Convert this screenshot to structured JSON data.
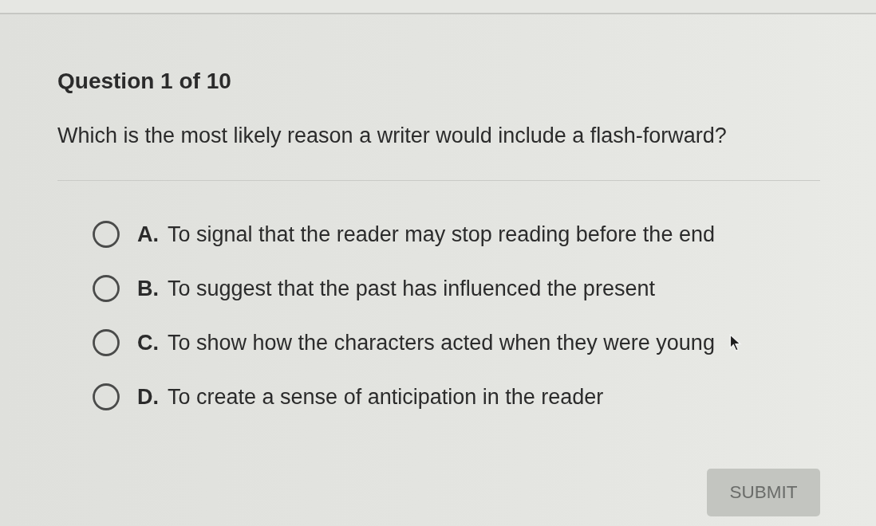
{
  "quiz": {
    "progress": "Question 1 of 10",
    "question": "Which is the most likely reason a writer would include a flash-forward?",
    "options": [
      {
        "label": "**A.** To signal that the reader may stop reading before the end",
        "selected": false
      },
      {
        "label": "**B.** To suggest that the past has influenced the present",
        "selected": false
      },
      {
        "label": "**C.** To show how the characters acted when they were young",
        "selected": false
      },
      {
        "label": "**D.** To create a sense of anticipation in the reader",
        "selected": false
      }
    ]
  },
  "submit": {
    "label": "SUBMIT",
    "disabled": true
  }
}
